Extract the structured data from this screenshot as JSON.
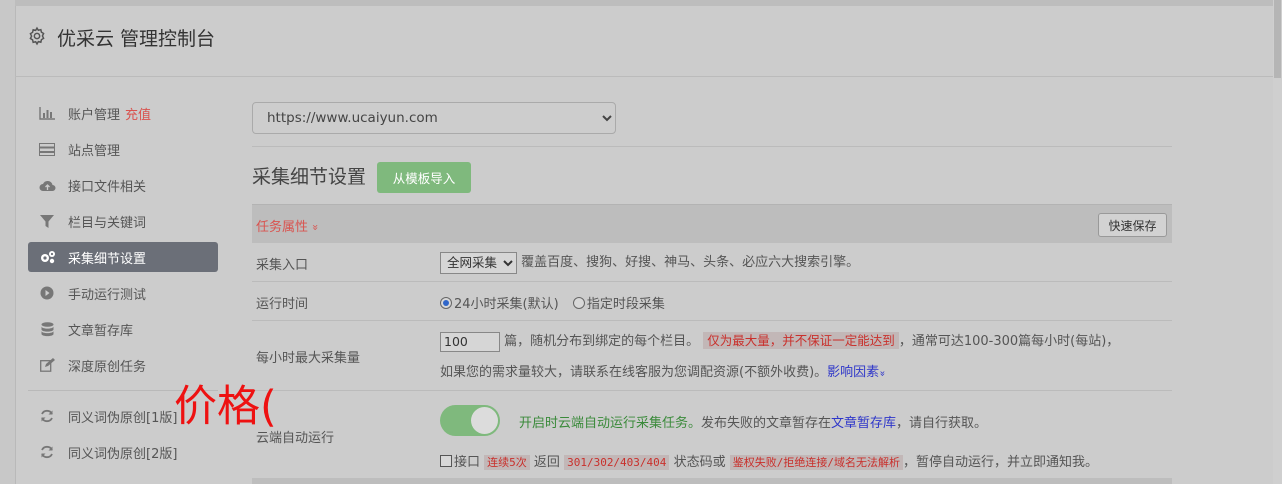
{
  "header": {
    "title": "优采云 管理控制台",
    "icon": "gear-icon"
  },
  "sidebar": {
    "items": [
      {
        "label": "账户管理",
        "badge": "充值",
        "icon": "bar-chart-icon"
      },
      {
        "label": "站点管理",
        "icon": "server-icon"
      },
      {
        "label": "接口文件相关",
        "icon": "cloud-upload-icon"
      },
      {
        "label": "栏目与关键词",
        "icon": "filter-icon"
      },
      {
        "label": "采集细节设置",
        "icon": "cogs-icon",
        "active": true
      },
      {
        "label": "手动运行测试",
        "icon": "play-circle-icon"
      },
      {
        "label": "文章暂存库",
        "icon": "database-icon"
      },
      {
        "label": "深度原创任务",
        "icon": "edit-icon"
      },
      {
        "label": "同义词伪原创[1版]",
        "icon": "refresh-icon"
      },
      {
        "label": "同义词伪原创[2版]",
        "icon": "refresh-icon"
      }
    ]
  },
  "site_select": {
    "value": "https://www.ucaiyun.com"
  },
  "section": {
    "title": "采集细节设置",
    "import_button": "从模板导入"
  },
  "table": {
    "header_label": "任务属性",
    "header_chevron": "»",
    "save_button": "快速保存",
    "rows": {
      "entry": {
        "label": "采集入口",
        "select_value": "全网采集",
        "desc": "覆盖百度、搜狗、好搜、神马、头条、必应六大搜索引擎。"
      },
      "run_time": {
        "label": "运行时间",
        "option1": "24小时采集(默认)",
        "option2": "指定时段采集"
      },
      "max_per_hour": {
        "label": "每小时最大采集量",
        "value": "100",
        "text1": "篇，随机分布到绑定的每个栏目。",
        "warn": "仅为最大量，并不保证一定能达到",
        "text2": "，通常可达100-300篇每小时(每站)，",
        "text3": "如果您的需求量较大，请联系在线客服为您调配资源(不额外收费)。",
        "link": "影响因素",
        "link_chevron": "»"
      },
      "cloud_auto": {
        "label": "云端自动运行",
        "toggle_on": true,
        "green_text": "开启时云端自动运行采集任务。",
        "text1": "发布失败的文章暂存在",
        "link": "文章暂存库",
        "text2": "，请自行获取。",
        "check_label": "接口",
        "warn1": "连续5次",
        "text3": "返回",
        "codes": "301/302/403/404",
        "text4": "状态码或",
        "warn2": "鉴权失败/拒绝连接/域名无法解析",
        "text5": "，暂停自动运行，并立即通知我。"
      }
    }
  },
  "overlay_text": "价格(",
  "colors": {
    "accent_green": "#7fb97d",
    "warn_red": "#d9534f",
    "link_blue": "#2e36c9",
    "active_nav": "#6b6f78"
  }
}
